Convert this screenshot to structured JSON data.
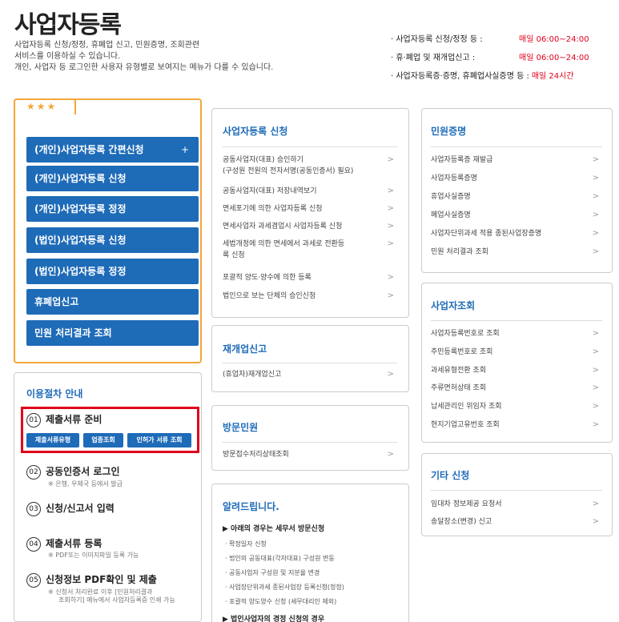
{
  "page": {
    "title": "사업자등록",
    "description": [
      "사업자등록 신청/정정, 휴폐업 신고, 민원증명, 조회관련",
      "서비스를 이용하실 수 있습니다.",
      "개인, 사업자 등 로그인한 사용자 유형별로 보여지는 메뉴가 다를 수 있습니다."
    ]
  },
  "hours": [
    {
      "label": "· 사업자등록 신청/정정 등 :",
      "value": "매일 06:00~24:00"
    },
    {
      "label": "· 휴·폐업 및 재개업신고 :",
      "value": "매일 06:00~24:00"
    },
    {
      "label": "· 사업자등록증·증명, 휴폐업사실증명 등 :",
      "value": "매일 24시간"
    }
  ],
  "quick": {
    "stars": "★★★",
    "buttons": [
      "(개인)사업자등록 간편신청",
      "(개인)사업자등록 신청",
      "(개인)사업자등록 정정",
      "(법인)사업자등록 신청",
      "(법인)사업자등록 정정",
      "휴폐업신고",
      "민원 처리결과 조회"
    ],
    "plus": "+"
  },
  "procedure": {
    "title": "이용절차 안내",
    "steps": [
      {
        "num": "01",
        "label": "제출서류 준비"
      },
      {
        "num": "02",
        "label": "공동인증서 로그인",
        "note": "※ 은행, 우체국 등에서 발급"
      },
      {
        "num": "03",
        "label": "신청/신고서 입력"
      },
      {
        "num": "04",
        "label": "제출서류 등록",
        "note": "※ PDF또는 이미지파일 등록 가능"
      },
      {
        "num": "05",
        "label": "신청정보 PDF확인 및 제출",
        "note1": "※ 신청서 처리완료 이후 [민원처리결과",
        "note2": "조회하기] 메뉴에서 사업자등록증 인쇄 가능"
      }
    ],
    "buttons": [
      "제출서류유형",
      "업종조회",
      "인허가 서류 조회"
    ]
  },
  "apply": {
    "title": "사업자등록 신청",
    "items": [
      "공동사업자(대표) 승인하기",
      "(구성원 전원의 전자서명(공동인증서) 필요)",
      "공동사업자(대표) 저장내역보기",
      "면세포기에 의한 사업자등록 신청",
      "면세사업자 과세겸업시 사업자등록 신청",
      "세법개정에 의한 면세에서 과세로 전환등",
      "록 신청",
      "포괄적 양도·양수에 의한 등록",
      "법인으로 보는 단체의 승인신청"
    ]
  },
  "reopen": {
    "title": "재개업신고",
    "items": [
      "(휴업자)재개업신고"
    ]
  },
  "visit": {
    "title": "방문민원",
    "items": [
      "방문접수처리상태조회"
    ]
  },
  "notice": {
    "title": "알려드립니다.",
    "subtitle": "▶ 아래의 경우는 세무서 방문신청",
    "lines": [
      "· 확정일자 신청",
      "· 법인의 공동대표(각자대표) 구성원 변동",
      "· 공동사업자 구성원 및 지분율 변경",
      "· 사업장단위과세 종된사업장 등록신청(정정)",
      "· 포괄적 양도양수 신청 (세무대리인 제외)"
    ],
    "more": "▶ 법인사업자의 경정 신청의 경우"
  },
  "certs": {
    "title": "민원증명",
    "items": [
      "사업자등록증 재발급",
      "사업자등록증명",
      "휴업사실증명",
      "폐업사실증명",
      "사업자단위과세 적용 종된사업장증명",
      "민원 처리결과 조회"
    ]
  },
  "lookup": {
    "title": "사업자조회",
    "items": [
      "사업자등록번호로 조회",
      "주민등록번호로 조회",
      "과세유형전환 조회",
      "주류면허상태 조회",
      "납세관리인 위임자 조회",
      "현지기업고유번호 조회"
    ]
  },
  "other": {
    "title": "기타 신청",
    "items": [
      "임대차 정보제공 요청서",
      "송달장소(변경) 신고"
    ]
  },
  "chevron": ">"
}
